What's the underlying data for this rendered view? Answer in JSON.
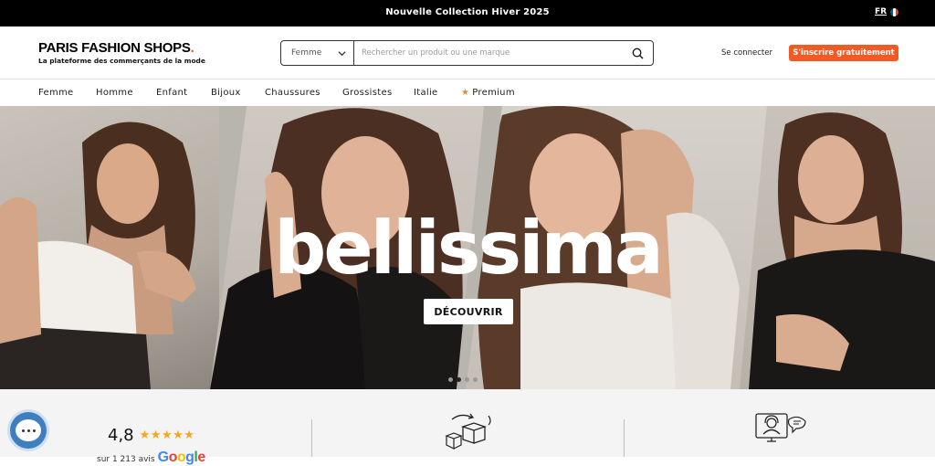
{
  "topbar": {
    "promo": "Nouvelle Collection Hiver 2025",
    "language": "FR",
    "flag_colors": [
      "#0055a4",
      "#ffffff",
      "#ef4135"
    ]
  },
  "header": {
    "logo_name": "PARIS FASHION SHOPS",
    "logo_dot": ".",
    "logo_tagline": "La plateforme des commerçants de la mode",
    "search": {
      "category": "Femme",
      "placeholder": "Rechercher un produit ou une marque",
      "icon": "search-icon"
    },
    "login": "Se connecter",
    "signup": "S'inscrire gratuitement",
    "accent": "#f05a24"
  },
  "nav": {
    "items": [
      "Femme",
      "Homme",
      "Enfant",
      "Bijoux",
      "Chaussures",
      "Grossistes",
      "Italie"
    ],
    "premium": "Premium"
  },
  "hero": {
    "title": "bellissima",
    "cta": "DÉCOUVRIR",
    "slides_total": 4,
    "active_slide": 2
  },
  "trust": {
    "rating_score": "4,8",
    "stars": "★★★★★",
    "reviews_prefix": "sur 1 213 avis",
    "google": "Google",
    "icons": [
      "delivery-boxes-icon",
      "customer-support-icon"
    ]
  },
  "chat": {
    "icon": "chat-bubble-icon"
  }
}
